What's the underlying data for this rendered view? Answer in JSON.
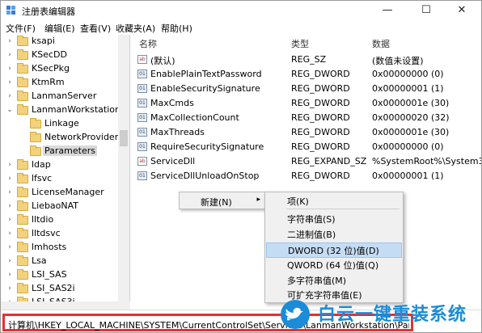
{
  "window": {
    "title": "注册表编辑器",
    "controls": {
      "minimize": "—",
      "maximize": "☐",
      "close": "✕"
    }
  },
  "menu": [
    "文件(F)",
    "编辑(E)",
    "查看(V)",
    "收藏夹(A)",
    "帮助(H)"
  ],
  "tree": [
    {
      "label": "ksapi",
      "expander": "›",
      "indent": 0
    },
    {
      "label": "KSecDD",
      "expander": "›",
      "indent": 0
    },
    {
      "label": "KSecPkg",
      "expander": "›",
      "indent": 0
    },
    {
      "label": "KtmRm",
      "expander": "›",
      "indent": 0
    },
    {
      "label": "LanmanServer",
      "expander": "›",
      "indent": 0
    },
    {
      "label": "LanmanWorkstation",
      "expander": "⌄",
      "indent": 0
    },
    {
      "label": "Linkage",
      "expander": "",
      "indent": 1
    },
    {
      "label": "NetworkProvider",
      "expander": "",
      "indent": 1
    },
    {
      "label": "Parameters",
      "expander": "",
      "indent": 1,
      "selected": true
    },
    {
      "label": "ldap",
      "expander": "›",
      "indent": 0
    },
    {
      "label": "lfsvc",
      "expander": "›",
      "indent": 0
    },
    {
      "label": "LicenseManager",
      "expander": "›",
      "indent": 0
    },
    {
      "label": "LiebaoNAT",
      "expander": "›",
      "indent": 0
    },
    {
      "label": "lltdio",
      "expander": "›",
      "indent": 0
    },
    {
      "label": "lltdsvc",
      "expander": "›",
      "indent": 0
    },
    {
      "label": "lmhosts",
      "expander": "›",
      "indent": 0
    },
    {
      "label": "Lsa",
      "expander": "›",
      "indent": 0
    },
    {
      "label": "LSI_SAS",
      "expander": "›",
      "indent": 0
    },
    {
      "label": "LSI_SAS2i",
      "expander": "›",
      "indent": 0
    },
    {
      "label": "LSI_SAS3i",
      "expander": "›",
      "indent": 0
    }
  ],
  "list": {
    "headers": {
      "name": "名称",
      "type": "类型",
      "data": "数据"
    },
    "rows": [
      {
        "icon": "ab",
        "name": "(默认)",
        "type": "REG_SZ",
        "data": "(数值未设置)"
      },
      {
        "icon": "01",
        "name": "EnablePlainTextPassword",
        "type": "REG_DWORD",
        "data": "0x00000000 (0)"
      },
      {
        "icon": "01",
        "name": "EnableSecuritySignature",
        "type": "REG_DWORD",
        "data": "0x00000001 (1)"
      },
      {
        "icon": "01",
        "name": "MaxCmds",
        "type": "REG_DWORD",
        "data": "0x0000001e (30)"
      },
      {
        "icon": "01",
        "name": "MaxCollectionCount",
        "type": "REG_DWORD",
        "data": "0x00000020 (32)"
      },
      {
        "icon": "01",
        "name": "MaxThreads",
        "type": "REG_DWORD",
        "data": "0x0000001e (30)"
      },
      {
        "icon": "01",
        "name": "RequireSecuritySignature",
        "type": "REG_DWORD",
        "data": "0x00000000 (0)"
      },
      {
        "icon": "ab",
        "name": "ServiceDll",
        "type": "REG_EXPAND_SZ",
        "data": "%SystemRoot%\\System32\\"
      },
      {
        "icon": "01",
        "name": "ServiceDllUnloadOnStop",
        "type": "REG_DWORD",
        "data": "0x00000001 (1)"
      }
    ]
  },
  "context_menu": {
    "new_label": "新建(N)",
    "arrow": "▸",
    "submenu": [
      "项(K)",
      "字符串值(S)",
      "二进制值(B)",
      "DWORD (32 位)值(D)",
      "QWORD (64 位)值(Q)",
      "多字符串值(M)",
      "可扩充字符串值(E)"
    ],
    "highlighted_index": 3
  },
  "status_bar": "计算机\\HKEY_LOCAL_MACHINE\\SYSTEM\\CurrentControlSet\\Services\\LanmanWorkstation\\Parameters",
  "watermark": {
    "text": "白云一键重装系统",
    "color": "#1a8cd8"
  }
}
